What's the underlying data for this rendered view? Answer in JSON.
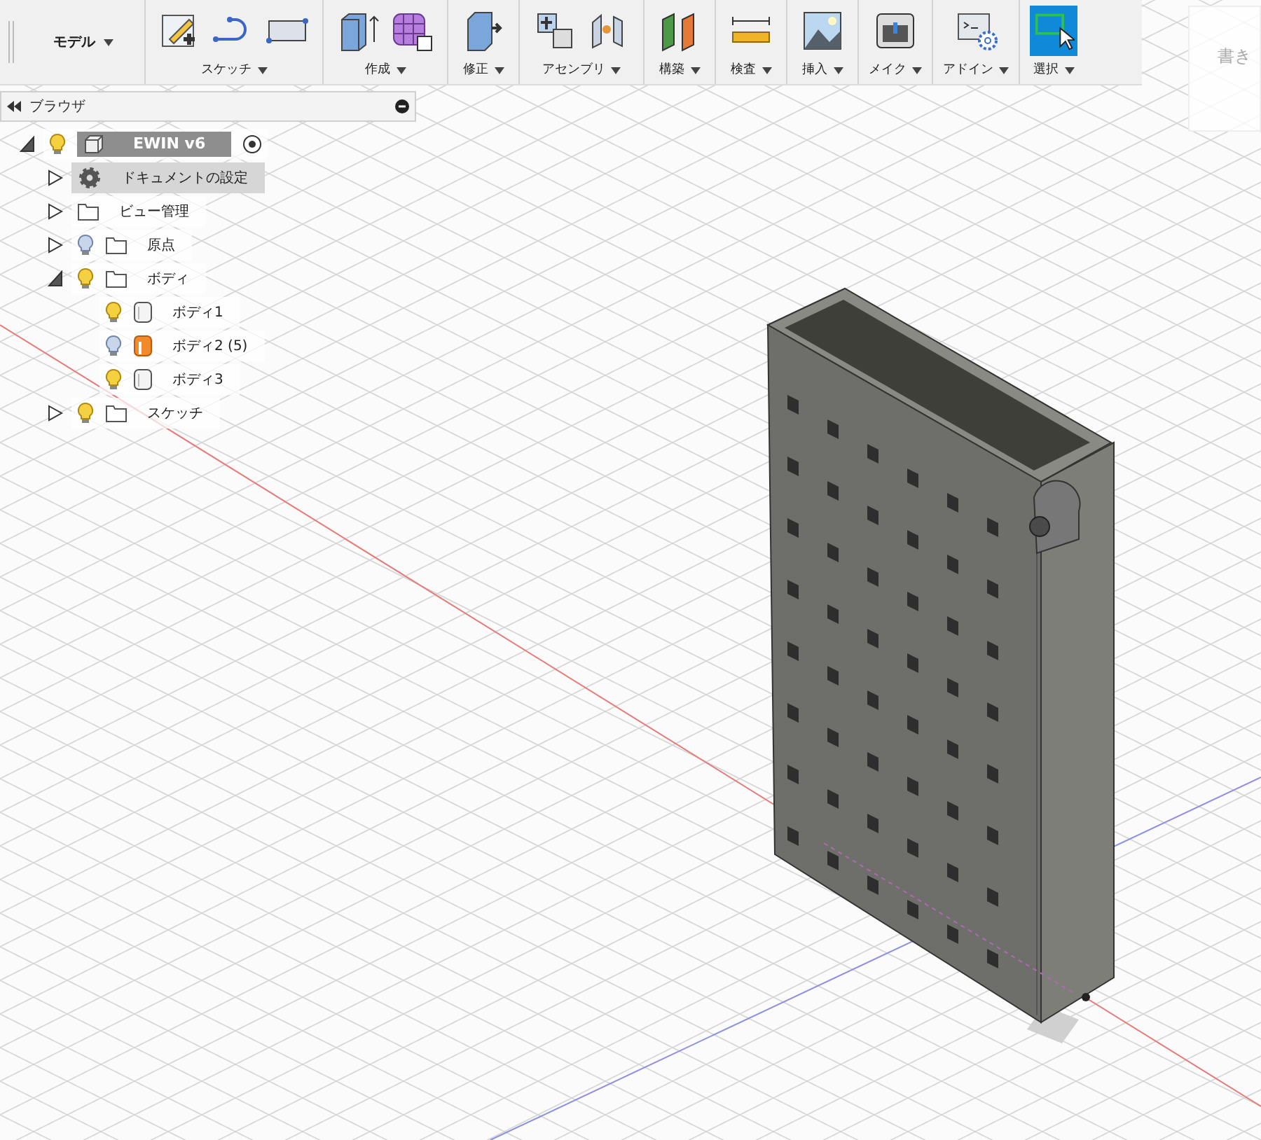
{
  "toolbar": {
    "workspace": "モデル",
    "groups": [
      {
        "kind": "sketch",
        "label": "スケッチ",
        "selected": false
      },
      {
        "kind": "create",
        "label": "作成",
        "selected": false
      },
      {
        "kind": "modify",
        "label": "修正",
        "selected": false
      },
      {
        "kind": "assemble",
        "label": "アセンブリ",
        "selected": false
      },
      {
        "kind": "construct",
        "label": "構築",
        "selected": false
      },
      {
        "kind": "inspect",
        "label": "検査",
        "selected": false
      },
      {
        "kind": "insert",
        "label": "挿入",
        "selected": false
      },
      {
        "kind": "make",
        "label": "メイク",
        "selected": false
      },
      {
        "kind": "addins",
        "label": "アドイン",
        "selected": false
      },
      {
        "kind": "select",
        "label": "選択",
        "selected": true
      }
    ]
  },
  "corner_panel": {
    "label": "書き"
  },
  "browser": {
    "title": "ブラウザ",
    "tree": [
      {
        "kind": "component",
        "label": "EWIN v6",
        "expanded": true,
        "visible": true,
        "children": [
          {
            "kind": "settings",
            "label": "ドキュメントの設定",
            "expanded": false,
            "hovered": true
          },
          {
            "kind": "folder",
            "label": "ビュー管理",
            "expanded": false
          },
          {
            "kind": "folder",
            "label": "原点",
            "expanded": false,
            "visible": false
          },
          {
            "kind": "folder",
            "label": "ボディ",
            "expanded": true,
            "visible": true,
            "children": [
              {
                "kind": "body",
                "label": "ボディ1",
                "visible": true
              },
              {
                "kind": "body-highlight",
                "label": "ボディ2 (5)",
                "visible": false
              },
              {
                "kind": "body",
                "label": "ボディ3",
                "visible": true
              }
            ]
          },
          {
            "kind": "folder",
            "label": "スケッチ",
            "expanded": false,
            "visible": true
          }
        ]
      }
    ]
  }
}
